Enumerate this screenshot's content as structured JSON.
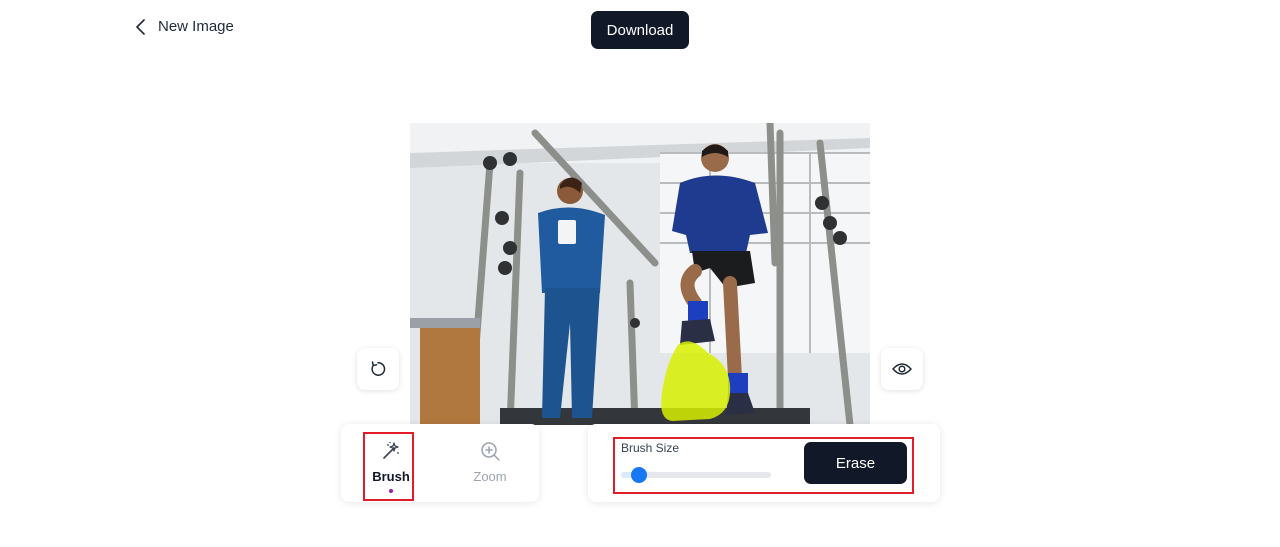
{
  "header": {
    "back_label": "New Image",
    "download_label": "Download"
  },
  "toolbar": {
    "tools": [
      {
        "label": "Brush",
        "icon": "magic-wand-icon",
        "active": true
      },
      {
        "label": "Zoom",
        "icon": "zoom-in-icon",
        "active": false
      }
    ]
  },
  "controls": {
    "brush_size_label": "Brush Size",
    "brush_size_fraction": 0.12,
    "erase_label": "Erase"
  },
  "side_buttons": {
    "left_icon": "reset-icon",
    "right_icon": "eye-icon"
  },
  "image": {
    "subject": "physical therapy session",
    "mask_color": "#d8f000"
  },
  "colors": {
    "primary_button": "#111827",
    "slider_thumb": "#1877f2",
    "highlight": "#e11d2a",
    "active_dot": "#a21caf"
  }
}
